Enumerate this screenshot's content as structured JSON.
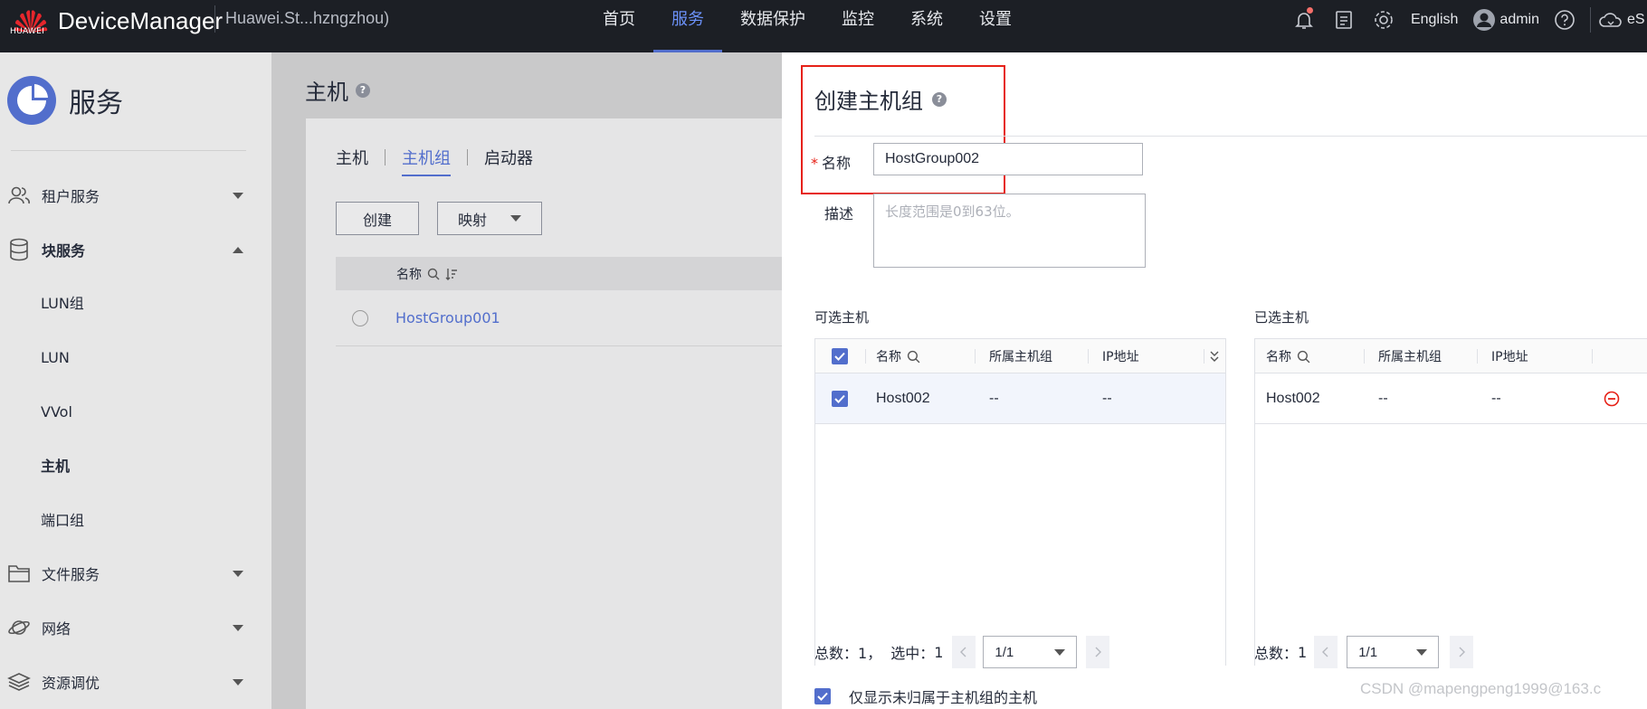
{
  "topbar": {
    "brand": "HUAWEI",
    "app_name": "DeviceManager",
    "device": "Huawei.St...hzngzhou)",
    "nav": [
      "首页",
      "服务",
      "数据保护",
      "监控",
      "系统",
      "设置"
    ],
    "language": "English",
    "user": "admin",
    "cloud_label": "eS"
  },
  "sidebar": {
    "title": "服务",
    "groups": {
      "tenant": "租户服务",
      "block": "块服务",
      "file": "文件服务",
      "network": "网络",
      "resource": "资源调优"
    },
    "block_items": [
      "LUN组",
      "LUN",
      "VVol",
      "主机",
      "端口组"
    ],
    "active_item": "主机"
  },
  "main": {
    "title": "主机",
    "tabs": [
      "主机",
      "主机组",
      "启动器"
    ],
    "active_tab": "主机组",
    "create_button": "创建",
    "map_button": "映射",
    "column_name": "名称",
    "rows": [
      "HostGroup001"
    ]
  },
  "drawer": {
    "title": "创建主机组",
    "name_label": "名称",
    "name_value": "HostGroup002",
    "desc_label": "描述",
    "desc_placeholder": "长度范围是0到63位。",
    "available": {
      "label": "可选主机",
      "columns": [
        "名称",
        "所属主机组",
        "IP地址"
      ],
      "rows": [
        {
          "name": "Host002",
          "group": "--",
          "ip": "--"
        }
      ],
      "total_label": "总数：",
      "total": "1，",
      "selected_label": "选中：",
      "selected": "1",
      "page": "1/1"
    },
    "selected": {
      "label": "已选主机",
      "columns": [
        "名称",
        "所属主机组",
        "IP地址"
      ],
      "rows": [
        {
          "name": "Host002",
          "group": "--",
          "ip": "--"
        }
      ],
      "total_label": "总数：",
      "total": "1",
      "page": "1/1"
    },
    "only_unassigned": "仅显示未归属于主机组的主机"
  },
  "watermark": "CSDN @mapengpeng1999@163.c",
  "colors": {
    "accent": "#526ecc",
    "topbar": "#1c1f25",
    "danger": "#e62117"
  }
}
